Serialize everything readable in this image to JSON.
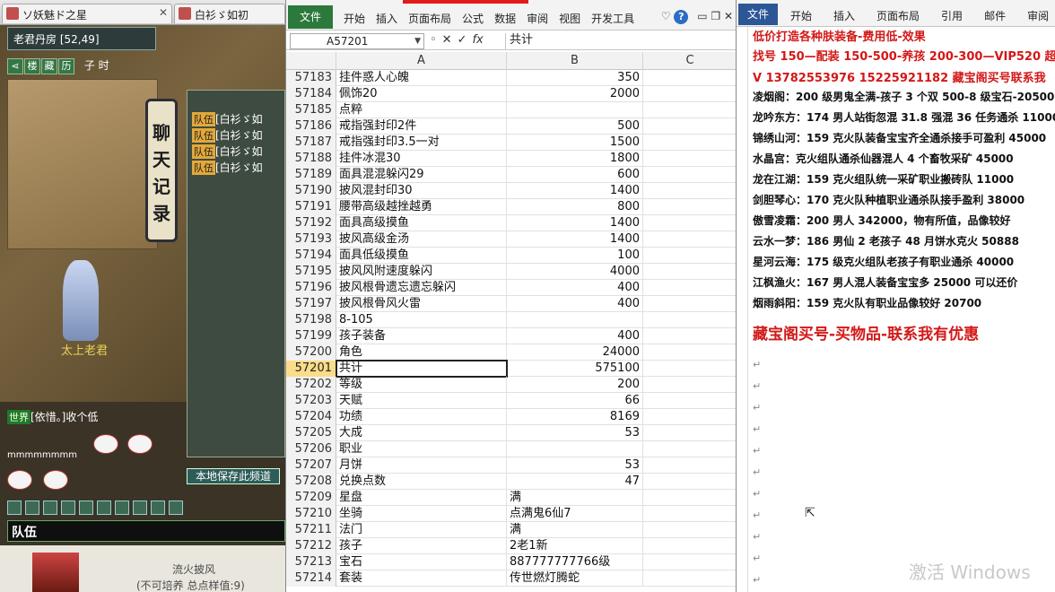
{
  "game": {
    "tabs": [
      {
        "label": "ソ妖魅ド之星"
      },
      {
        "label": "白衫ゞ如初"
      }
    ],
    "room_name": "老君丹房",
    "room_coords": "[52,49]",
    "quick_buttons": [
      "楼",
      "藏",
      "历"
    ],
    "time_label": "子 时",
    "banner_text": "聊天记录",
    "chat_lines": [
      {
        "badge": "队伍",
        "text": "[白衫ゞ如"
      },
      {
        "badge": "队伍",
        "text": "[白衫ゞ如"
      },
      {
        "badge": "队伍",
        "text": "[白衫ゞ如"
      },
      {
        "badge": "队伍",
        "text": "[白衫ゞ如"
      }
    ],
    "save_button": "本地保存此频道",
    "npc_name": "太上老君",
    "world_badge": "世界",
    "world_text": "[依惜。]收个低",
    "emote_text": "mmmmmmmm",
    "input_label": "队伍",
    "bottom_title": "流火披风",
    "bottom_subtitle": "(不可培养 总点样值:9)"
  },
  "excel": {
    "file_tab": "文件",
    "tabs": [
      "开始",
      "插入",
      "页面布局",
      "公式",
      "数据",
      "审阅",
      "视图",
      "开发工具"
    ],
    "help_icon": "?",
    "cell_ref": "A57201",
    "formula_value": "共计",
    "columns": [
      "A",
      "B",
      "C"
    ],
    "rows": [
      {
        "n": "57183",
        "a": "挂件惑人心魄",
        "b": "350",
        "num": true
      },
      {
        "n": "57184",
        "a": "佩饰20",
        "b": "2000",
        "num": true
      },
      {
        "n": "57185",
        "a": "点粹",
        "b": "",
        "num": true
      },
      {
        "n": "57186",
        "a": "戒指强封印2件",
        "b": "500",
        "num": true
      },
      {
        "n": "57187",
        "a": "戒指强封印3.5一对",
        "b": "1500",
        "num": true
      },
      {
        "n": "57188",
        "a": "挂件冰混30",
        "b": "1800",
        "num": true
      },
      {
        "n": "57189",
        "a": "面具混混躲闪29",
        "b": "600",
        "num": true
      },
      {
        "n": "57190",
        "a": "披风混封印30",
        "b": "1400",
        "num": true
      },
      {
        "n": "57191",
        "a": "腰带高级越挫越勇",
        "b": "800",
        "num": true
      },
      {
        "n": "57192",
        "a": "面具高级摸鱼",
        "b": "1400",
        "num": true
      },
      {
        "n": "57193",
        "a": "披风高级金汤",
        "b": "1400",
        "num": true
      },
      {
        "n": "57194",
        "a": "面具低级摸鱼",
        "b": "100",
        "num": true
      },
      {
        "n": "57195",
        "a": "披风风附速度躲闪",
        "b": "4000",
        "num": true
      },
      {
        "n": "57196",
        "a": "披风根骨遗忘遗忘躲闪",
        "b": "400",
        "num": true
      },
      {
        "n": "57197",
        "a": "披风根骨风火雷",
        "b": "400",
        "num": true
      },
      {
        "n": "57198",
        "a": "8-105",
        "b": "",
        "num": true
      },
      {
        "n": "57199",
        "a": "孩子装备",
        "b": "400",
        "num": true
      },
      {
        "n": "57200",
        "a": "角色",
        "b": "24000",
        "num": true
      },
      {
        "n": "57201",
        "a": "共计",
        "b": "575100",
        "num": true,
        "active": true
      },
      {
        "n": "57202",
        "a": "等级",
        "b": "200",
        "num": true
      },
      {
        "n": "57203",
        "a": "天赋",
        "b": "66",
        "num": true
      },
      {
        "n": "57204",
        "a": "功绩",
        "b": "8169",
        "num": true
      },
      {
        "n": "57205",
        "a": "大成",
        "b": "53",
        "num": true
      },
      {
        "n": "57206",
        "a": "职业",
        "b": "",
        "num": true
      },
      {
        "n": "57207",
        "a": "月饼",
        "b": "53",
        "num": true
      },
      {
        "n": "57208",
        "a": "兑换点数",
        "b": "47",
        "num": true
      },
      {
        "n": "57209",
        "a": "星盘",
        "b": "满",
        "num": false
      },
      {
        "n": "57210",
        "a": "坐骑",
        "b": "点满鬼6仙7",
        "num": false
      },
      {
        "n": "57211",
        "a": "法门",
        "b": "满",
        "num": false
      },
      {
        "n": "57212",
        "a": "孩子",
        "b": "2老1新",
        "num": false
      },
      {
        "n": "57213",
        "a": "宝石",
        "b": "887777777766级",
        "num": false
      },
      {
        "n": "57214",
        "a": "套装",
        "b": "传世燃灯腾蛇",
        "num": false
      }
    ]
  },
  "word": {
    "file_tab": "文件",
    "tabs": [
      "开始",
      "插入",
      "页面布局",
      "引用",
      "邮件",
      "审阅"
    ],
    "top_red": "低价打造各种肤装备-费用低-效果",
    "red_lines": [
      "找号 150—配装 150-500-养孩 200-300—VIP520 超级",
      "V 13782553976    15225921182   藏宝阁买号联系我"
    ],
    "listings": [
      "凌烟阁：200 级男鬼全满-孩子 3 个双 500-8 级宝石-20500",
      "龙吟东方：174 男人站街忽混 31.8 强混 36 任务通杀 11000",
      "锦绣山河：159 克火队装备宝宝齐全通杀接手可盈利 45000",
      "水晶宫：克火组队通杀仙器混人 4 个畜牧采矿 45000",
      "龙在江湖：159 克火组队统一采矿职业搬砖队 11000",
      "剑胆琴心：170 克火队种植职业通杀队接手盈利 38000",
      "傲雪凌霜：200 男人 342000，物有所值，品像较好",
      "云水一梦：186 男仙 2 老孩子 48 月饼水克火 50888",
      "星河云海：175 级克火组队老孩子有职业通杀 40000",
      "江枫渔火：167 男人混人装备宝宝多 25000 可以还价",
      "烟雨斜阳：159 克火队有职业品像较好 20700"
    ],
    "headline": "藏宝阁买号-买物品-联系我有优惠",
    "paragraph_mark": "↵",
    "watermark": "激活 Windows"
  }
}
